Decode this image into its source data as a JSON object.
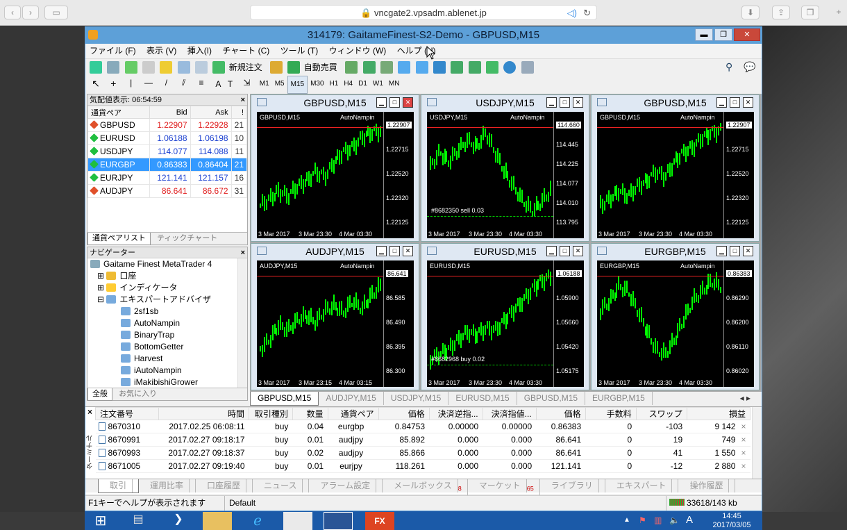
{
  "browser": {
    "url": "vncgate2.vpsadm.ablenet.jp"
  },
  "window": {
    "title": "314179: GaitameFinest-S2-Demo - GBPUSD,M15"
  },
  "menu": [
    "ファイル (F)",
    "表示 (V)",
    "挿入(I)",
    "チャート (C)",
    "ツール (T)",
    "ウィンドウ (W)",
    "ヘルプ (H)"
  ],
  "toolbar": {
    "new_order": "新規注文",
    "auto_trade": "自動売買",
    "draw_a": "A",
    "draw_t": "T",
    "timeframes": [
      "M1",
      "M5",
      "M15",
      "M30",
      "H1",
      "H4",
      "D1",
      "W1",
      "MN"
    ],
    "active_tf": "M15"
  },
  "quotes": {
    "title": "気配値表示: 06:54:59",
    "headers": [
      "通貨ペア",
      "Bid",
      "Ask",
      "!"
    ],
    "rows": [
      {
        "sym": "GBPUSD",
        "bid": "1.22907",
        "ask": "1.22928",
        "spread": "21",
        "dir": "down"
      },
      {
        "sym": "EURUSD",
        "bid": "1.06188",
        "ask": "1.06198",
        "spread": "10",
        "dir": "up"
      },
      {
        "sym": "USDJPY",
        "bid": "114.077",
        "ask": "114.088",
        "spread": "11",
        "dir": "up"
      },
      {
        "sym": "EURGBP",
        "bid": "0.86383",
        "ask": "0.86404",
        "spread": "21",
        "dir": "up"
      },
      {
        "sym": "EURJPY",
        "bid": "121.141",
        "ask": "121.157",
        "spread": "16",
        "dir": "up"
      },
      {
        "sym": "AUDJPY",
        "bid": "86.641",
        "ask": "86.672",
        "spread": "31",
        "dir": "down"
      }
    ],
    "tabs": [
      "通貨ペアリスト",
      "ティックチャート"
    ]
  },
  "navigator": {
    "title": "ナビゲーター",
    "root": "Gaitame Finest MetaTrader 4",
    "items": [
      "口座",
      "インディケータ",
      "エキスパートアドバイザ"
    ],
    "experts": [
      "2sf1sb",
      "AutoNampin",
      "BinaryTrap",
      "BottomGetter",
      "Harvest",
      "iAutoNampin",
      "iMakibishiGrower"
    ],
    "tabs": [
      "全般",
      "お気に入り"
    ]
  },
  "charts": [
    {
      "title": "GBPUSD,M15",
      "label": "GBPUSD,M15",
      "ea": "AutoNampin",
      "prices": [
        "1.22907",
        "1.22715",
        "1.22520",
        "1.22320",
        "1.22125"
      ],
      "dates": [
        "3 Mar 2017",
        "3 Mar 23:30",
        "4 Mar 03:30"
      ],
      "order": "",
      "series": [
        0.15,
        0.22,
        0.3,
        0.25,
        0.35,
        0.4,
        0.5,
        0.45,
        0.6,
        0.7,
        0.75,
        0.85,
        0.9,
        0.92
      ]
    },
    {
      "title": "USDJPY,M15",
      "label": "USDJPY,M15",
      "ea": "AutoNampin",
      "prices": [
        "114.660",
        "114.445",
        "114.225",
        "114.077",
        "114.010",
        "113.795"
      ],
      "dates": [
        "3 Mar 2017",
        "3 Mar 23:30",
        "4 Mar 03:30"
      ],
      "order": "#8682350 sell 0.03",
      "series": [
        0.55,
        0.7,
        0.6,
        0.72,
        0.82,
        0.75,
        0.9,
        0.7,
        0.5,
        0.35,
        0.2,
        0.1,
        0.18,
        0.3
      ]
    },
    {
      "title": "GBPUSD,M15",
      "label": "GBPUSD,M15",
      "ea": "AutoNampin",
      "prices": [
        "1.22907",
        "1.22715",
        "1.22520",
        "1.22320",
        "1.22125"
      ],
      "dates": [
        "3 Mar 2017",
        "3 Mar 23:30",
        "4 Mar 03:30"
      ],
      "order": "",
      "series": [
        0.15,
        0.22,
        0.3,
        0.25,
        0.35,
        0.4,
        0.5,
        0.45,
        0.6,
        0.7,
        0.75,
        0.85,
        0.9,
        0.92
      ]
    },
    {
      "title": "AUDJPY,M15",
      "label": "AUDJPY,M15",
      "ea": "AutoNampin",
      "prices": [
        "86.641",
        "86.585",
        "86.490",
        "86.395",
        "86.300"
      ],
      "dates": [
        "3 Mar 2017",
        "3 Mar 23:15",
        "4 Mar 03:15"
      ],
      "order": "",
      "series": [
        0.2,
        0.3,
        0.45,
        0.4,
        0.5,
        0.55,
        0.48,
        0.6,
        0.65,
        0.58,
        0.7,
        0.62,
        0.75,
        0.85
      ]
    },
    {
      "title": "EURUSD,M15",
      "label": "EURUSD,M15",
      "ea": "",
      "prices": [
        "1.06188",
        "1.05900",
        "1.05660",
        "1.05420",
        "1.05175"
      ],
      "dates": [
        "3 Mar 2017",
        "3 Mar 23:30",
        "4 Mar 03:30"
      ],
      "order": "#8682968 buy 0.02",
      "series": [
        0.1,
        0.15,
        0.2,
        0.3,
        0.38,
        0.35,
        0.42,
        0.4,
        0.5,
        0.6,
        0.7,
        0.82,
        0.9,
        0.95
      ]
    },
    {
      "title": "EURGBP,M15",
      "label": "EURGBP,M15",
      "ea": "AutoNampin",
      "prices": [
        "0.86383",
        "0.86290",
        "0.86200",
        "0.86110",
        "0.86020"
      ],
      "dates": [
        "3 Mar 2017",
        "3 Mar 23:30",
        "4 Mar 03:30"
      ],
      "order": "",
      "series": [
        0.6,
        0.7,
        0.85,
        0.8,
        0.6,
        0.4,
        0.2,
        0.15,
        0.3,
        0.5,
        0.7,
        0.8,
        0.9,
        0.85
      ]
    }
  ],
  "chart_tabs": [
    "GBPUSD,M15",
    "AUDJPY,M15",
    "USDJPY,M15",
    "EURUSD,M15",
    "GBPUSD,M15",
    "EURGBP,M15"
  ],
  "terminal": {
    "headers": [
      "注文番号",
      "時間",
      "取引種別",
      "数量",
      "通貨ペア",
      "価格",
      "決済逆指...",
      "決済指値...",
      "価格",
      "手数料",
      "スワップ",
      "損益"
    ],
    "rows": [
      [
        "8670310",
        "2017.02.25 06:08:11",
        "buy",
        "0.04",
        "eurgbp",
        "0.84753",
        "0.00000",
        "0.00000",
        "0.86383",
        "0",
        "-103",
        "9 142"
      ],
      [
        "8670991",
        "2017.02.27 09:18:17",
        "buy",
        "0.01",
        "audjpy",
        "85.892",
        "0.000",
        "0.000",
        "86.641",
        "0",
        "19",
        "749"
      ],
      [
        "8670993",
        "2017.02.27 09:18:37",
        "buy",
        "0.02",
        "audjpy",
        "85.866",
        "0.000",
        "0.000",
        "86.641",
        "0",
        "41",
        "1 550"
      ],
      [
        "8671005",
        "2017.02.27 09:19:40",
        "buy",
        "0.01",
        "eurjpy",
        "118.261",
        "0.000",
        "0.000",
        "121.141",
        "0",
        "-12",
        "2 880"
      ]
    ],
    "vertical_label": "ターミナル",
    "tabs": [
      {
        "label": "取引",
        "badge": ""
      },
      {
        "label": "運用比率",
        "badge": ""
      },
      {
        "label": "口座履歴",
        "badge": ""
      },
      {
        "label": "ニュース",
        "badge": ""
      },
      {
        "label": "アラーム設定",
        "badge": ""
      },
      {
        "label": "メールボックス",
        "badge": "8"
      },
      {
        "label": "マーケット",
        "badge": "65"
      },
      {
        "label": "ライブラリ",
        "badge": ""
      },
      {
        "label": "エキスパート",
        "badge": ""
      },
      {
        "label": "操作履歴",
        "badge": ""
      }
    ]
  },
  "status": {
    "help": "F1キーでヘルプが表示されます",
    "profile": "Default",
    "traffic": "33618/143 kb"
  },
  "taskbar": {
    "time": "14:45",
    "date": "2017/03/05",
    "ime": "A"
  },
  "colors": {
    "up": "#1fbf3f",
    "down": "#e0502a",
    "bid_ask_red": "#e02020",
    "bid_ask_blue": "#1a3fd0",
    "selected": "#3399ff",
    "candle": "#00ff00"
  }
}
